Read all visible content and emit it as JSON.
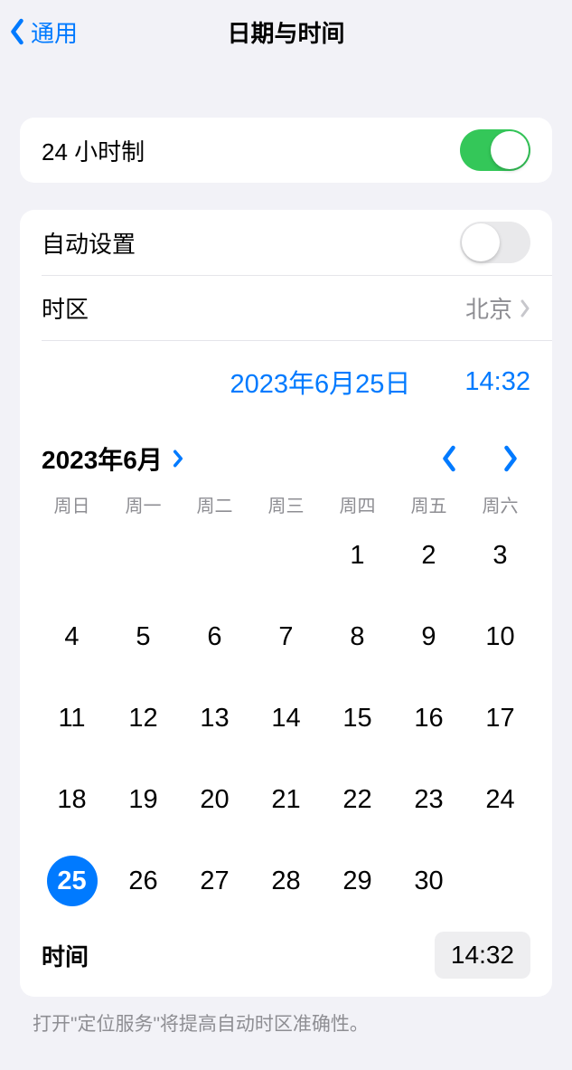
{
  "navbar": {
    "back_label": "通用",
    "title": "日期与时间"
  },
  "group1": {
    "h24_label": "24 小时制",
    "h24_on": true
  },
  "group2": {
    "auto_label": "自动设置",
    "auto_on": false,
    "timezone_label": "时区",
    "timezone_value": "北京",
    "date_display": "2023年6月25日",
    "time_display": "14:32",
    "month_label": "2023年6月",
    "weekdays": [
      "周日",
      "周一",
      "周二",
      "周三",
      "周四",
      "周五",
      "周六"
    ],
    "days": [
      "",
      "",
      "",
      "",
      "1",
      "2",
      "3",
      "4",
      "5",
      "6",
      "7",
      "8",
      "9",
      "10",
      "11",
      "12",
      "13",
      "14",
      "15",
      "16",
      "17",
      "18",
      "19",
      "20",
      "21",
      "22",
      "23",
      "24",
      "25",
      "26",
      "27",
      "28",
      "29",
      "30"
    ],
    "selected_day": "25",
    "time_row_label": "时间",
    "time_row_value": "14:32"
  },
  "footer": {
    "note": "打开\"定位服务\"将提高自动时区准确性。"
  }
}
